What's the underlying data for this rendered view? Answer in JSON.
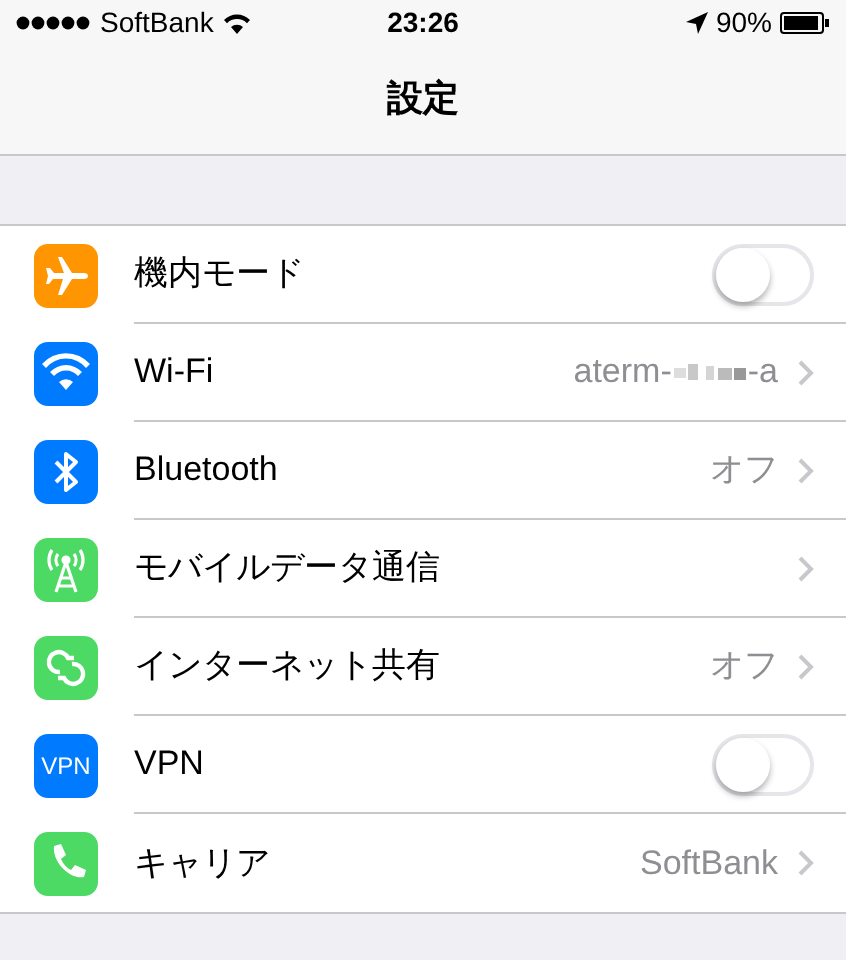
{
  "status_bar": {
    "carrier": "SoftBank",
    "time": "23:26",
    "battery": "90%"
  },
  "nav_bar": {
    "title": "設定"
  },
  "rows": [
    {
      "kind": "toggle",
      "color": "#ff9500",
      "label": "機内モード",
      "on": false
    },
    {
      "kind": "link",
      "color": "#007aff",
      "label": "Wi-Fi",
      "value_prefix": "aterm-",
      "value_suffix": "-a"
    },
    {
      "kind": "link",
      "color": "#007aff",
      "label": "Bluetooth",
      "value": "オフ"
    },
    {
      "kind": "link",
      "color": "#4cd964",
      "label": "モバイルデータ通信"
    },
    {
      "kind": "link",
      "color": "#4cd964",
      "label": "インターネット共有",
      "value": "オフ"
    },
    {
      "kind": "toggle",
      "icon_text": "VPN",
      "color": "#007aff",
      "label": "VPN",
      "on": false
    },
    {
      "kind": "link",
      "color": "#4cd964",
      "label": "キャリア",
      "value": "SoftBank"
    }
  ]
}
